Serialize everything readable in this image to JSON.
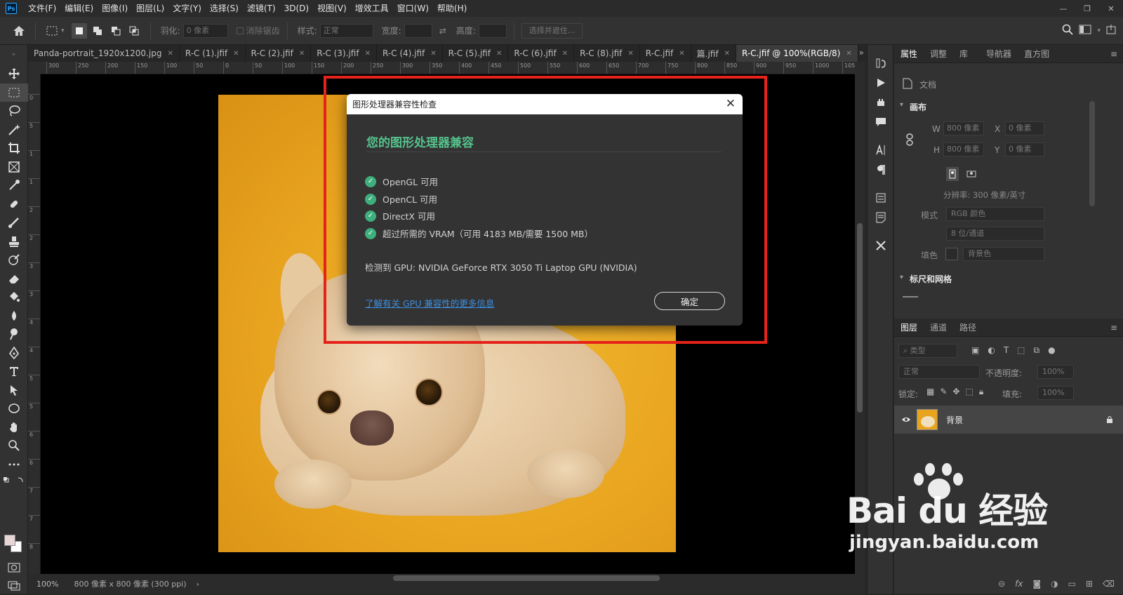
{
  "app": {
    "logo": "Ps"
  },
  "menubar": {
    "items": [
      "文件(F)",
      "编辑(E)",
      "图像(I)",
      "图层(L)",
      "文字(Y)",
      "选择(S)",
      "滤镜(T)",
      "3D(D)",
      "视图(V)",
      "增效工具",
      "窗口(W)",
      "帮助(H)"
    ]
  },
  "window_controls": {
    "minimize": "—",
    "restore": "❐",
    "close": "✕"
  },
  "options": {
    "feather_label": "羽化:",
    "feather_value": "0 像素",
    "antialias_label": "消除锯齿",
    "style_label": "样式:",
    "style_value": "正常",
    "width_label": "宽度:",
    "height_label": "高度:",
    "select_mask_label": "选择并遮住..."
  },
  "tabs": [
    {
      "label": "Panda-portrait_1920x1200.jpg"
    },
    {
      "label": "R-C (1).jfif"
    },
    {
      "label": "R-C (2).jfif"
    },
    {
      "label": "R-C (3).jfif"
    },
    {
      "label": "R-C (4).jfif"
    },
    {
      "label": "R-C (5).jfif"
    },
    {
      "label": "R-C (6).jfif"
    },
    {
      "label": "R-C (8).jfif"
    },
    {
      "label": "R-C.jfif"
    },
    {
      "label": "篇.jfif"
    },
    {
      "label": "R-C.jfif @ 100%(RGB/8)"
    }
  ],
  "tab_more": "»",
  "ruler_h": [
    "300",
    "250",
    "200",
    "150",
    "100",
    "50",
    "0",
    "50",
    "100",
    "150",
    "200",
    "250",
    "300",
    "350",
    "400",
    "450",
    "500",
    "550",
    "600",
    "650",
    "700",
    "750",
    "800",
    "850",
    "900",
    "950",
    "1000",
    "1050"
  ],
  "ruler_v": [
    "0",
    "5",
    "1",
    "1",
    "2",
    "2",
    "3",
    "3",
    "4",
    "4",
    "5",
    "5",
    "6",
    "6",
    "7",
    "7",
    "8"
  ],
  "status": {
    "zoom": "100%",
    "doc_info": "800 像素 x 800 像素 (300 ppi)",
    "arrow": "›"
  },
  "properties": {
    "tabs": [
      "属性",
      "调整",
      "库",
      "导航器",
      "直方图"
    ],
    "doc_label": "文档",
    "canvas_section": "画布",
    "w_label": "W",
    "w_value": "800 像素",
    "h_label": "H",
    "h_value": "800 像素",
    "x_label": "X",
    "x_value": "0 像素",
    "y_label": "Y",
    "y_value": "0 像素",
    "resolution": "分辨率: 300 像素/英寸",
    "mode_label": "模式",
    "mode_value": "RGB 颜色",
    "depth_value": "8 位/通道",
    "fill_label": "填色",
    "fill_value": "背景色",
    "rulers_section": "标尺和网格"
  },
  "layers": {
    "tabs": [
      "图层",
      "通道",
      "路径"
    ],
    "filter_value": "类型",
    "blend_value": "正常",
    "opacity_label": "不透明度:",
    "opacity_value": "100%",
    "lock_label": "锁定:",
    "fill_label": "填充:",
    "fill_value": "100%",
    "layer_name": "背景"
  },
  "dialog": {
    "title": "图形处理器兼容性检查",
    "heading": "您的图形处理器兼容",
    "checks": [
      "OpenGL 可用",
      "OpenCL 可用",
      "DirectX 可用",
      "超过所需的 VRAM（可用 4183 MB/需要 1500 MB）"
    ],
    "gpu_detected": "检测到 GPU: NVIDIA GeForce RTX 3050 Ti Laptop GPU (NVIDIA)",
    "link": "了解有关 GPU 兼容性的更多信息",
    "ok": "确定"
  },
  "watermark": {
    "main": "Bai du 经验",
    "sub": "jingyan.baidu.com"
  },
  "colors": {
    "accent_green": "#55c28c",
    "check_green": "#3eaf7c",
    "link_blue": "#3d8fe0",
    "annotation_red": "#e6231a",
    "photo_yellow": "#e9a520"
  }
}
